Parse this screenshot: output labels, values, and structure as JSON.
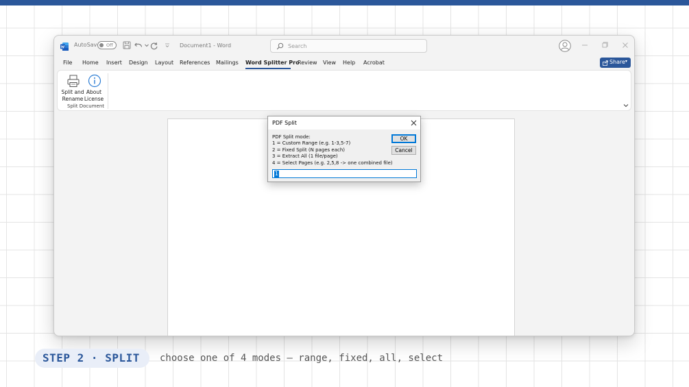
{
  "word": {
    "autosave_label": "AutoSave",
    "autosave_state": "Off",
    "document_title": "Document1 - Word",
    "search_placeholder": "Search",
    "share_label": "Share",
    "menu": [
      "File",
      "Home",
      "Insert",
      "Design",
      "Layout",
      "References",
      "Mailings",
      "Word Splitter Pro",
      "Review",
      "View",
      "Help",
      "Acrobat"
    ],
    "active_tab": "Word Splitter Pro",
    "ribbon": {
      "split_button": [
        "Split and",
        "Rename"
      ],
      "about_button": [
        "About",
        "License"
      ],
      "group_label": "Split Document"
    }
  },
  "dialog": {
    "title": "PDF Split",
    "prompt": [
      "PDF Split mode:",
      "1 = Custom Range (e.g. 1-3,5-7)",
      "2 = Fixed Split (N pages each)",
      "3 = Extract All (1 file/page)",
      "4 = Select Pages (e.g. 2,5,8 -> one combined file)"
    ],
    "ok_label": "OK",
    "cancel_label": "Cancel",
    "input_value": "1"
  },
  "caption": {
    "step": "STEP 2 · SPLIT",
    "description": "choose one of 4 modes — range, fixed, all, select"
  },
  "colors": {
    "accent": "#2b579a",
    "dialog_focus": "#0078d7"
  }
}
